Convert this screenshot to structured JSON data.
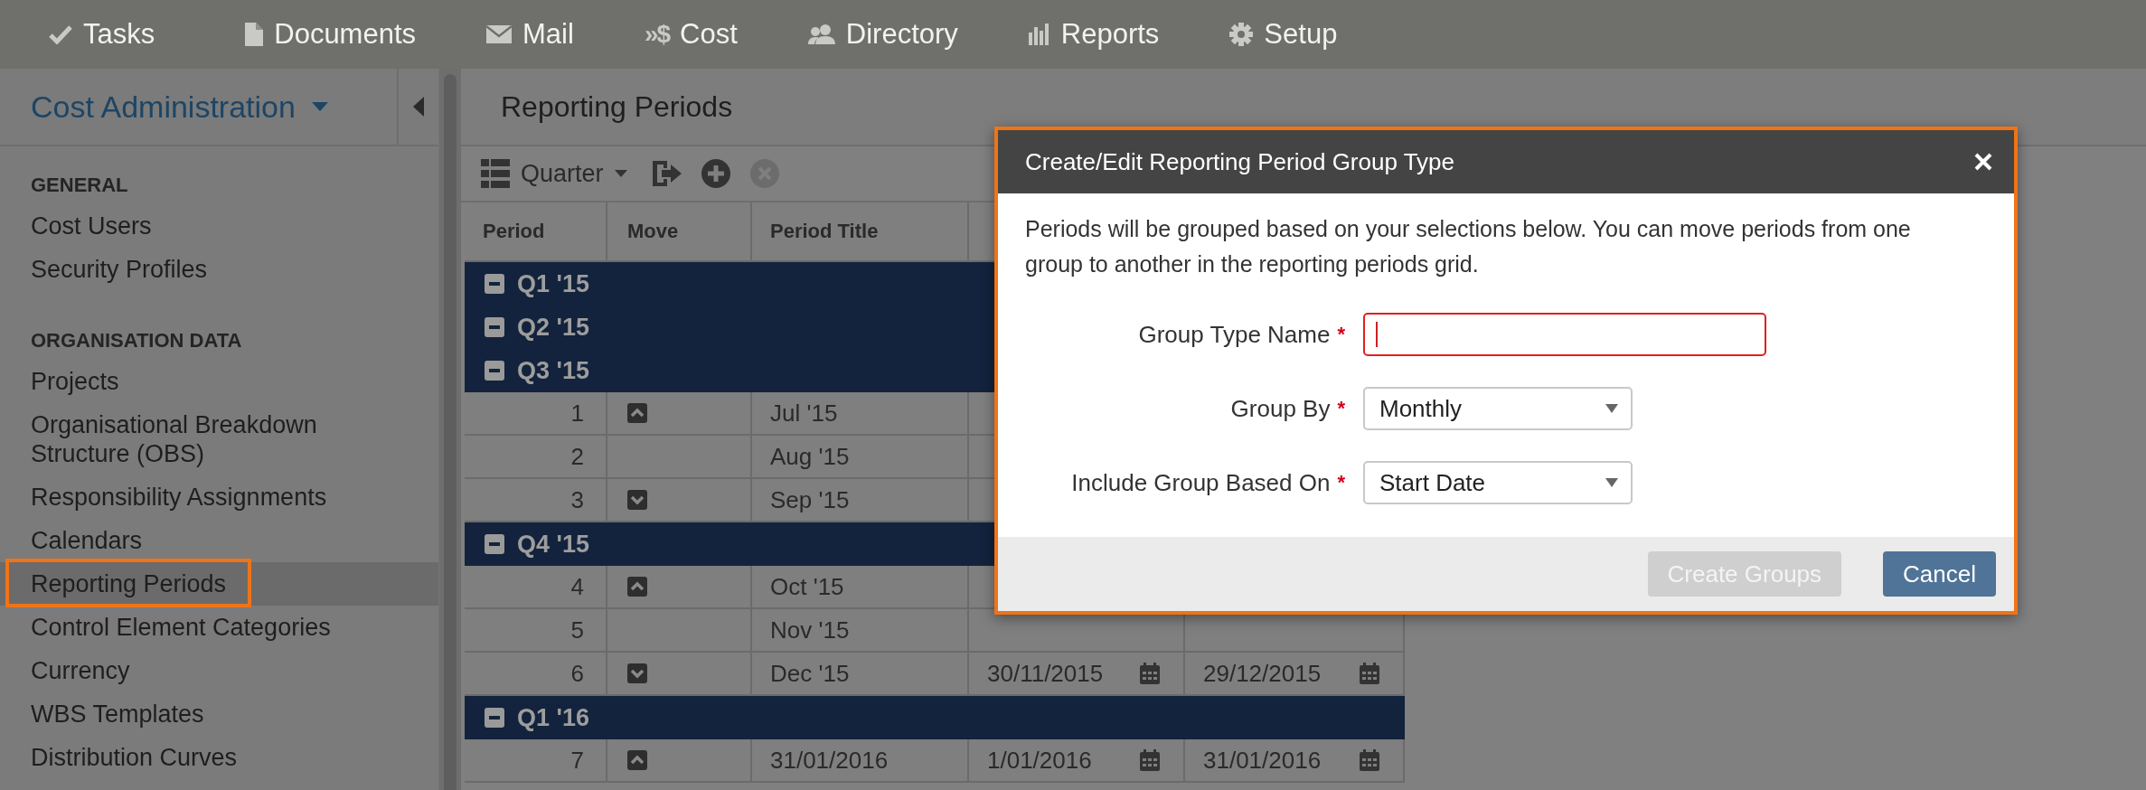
{
  "nav": [
    {
      "label": "Tasks"
    },
    {
      "label": "Documents"
    },
    {
      "label": "Mail"
    },
    {
      "label": "Cost",
      "glyph": "»$"
    },
    {
      "label": "Directory"
    },
    {
      "label": "Reports"
    },
    {
      "label": "Setup"
    }
  ],
  "sidebar": {
    "title": "Cost Administration",
    "sections": [
      {
        "heading": "GENERAL",
        "items": [
          {
            "label": "Cost Users",
            "selected": false
          },
          {
            "label": "Security Profiles",
            "selected": false
          }
        ]
      },
      {
        "heading": "ORGANISATION DATA",
        "items": [
          {
            "label": "Projects",
            "selected": false
          },
          {
            "label": "Organisational Breakdown Structure (OBS)",
            "selected": false
          },
          {
            "label": "Responsibility Assignments",
            "selected": false
          },
          {
            "label": "Calendars",
            "selected": false
          },
          {
            "label": "Reporting Periods",
            "selected": true
          },
          {
            "label": "Control Element Categories",
            "selected": false
          },
          {
            "label": "Currency",
            "selected": false
          },
          {
            "label": "WBS Templates",
            "selected": false
          },
          {
            "label": "Distribution Curves",
            "selected": false
          }
        ]
      }
    ]
  },
  "main": {
    "title": "Reporting Periods",
    "toolbar": {
      "group_by": "Quarter",
      "remove_disabled": true
    },
    "grid": {
      "columns": [
        "Period",
        "Move",
        "Period Title"
      ],
      "rows": [
        {
          "kind": "group",
          "label": "Q1 '15",
          "expanded": true
        },
        {
          "kind": "group",
          "label": "Q2 '15",
          "expanded": true
        },
        {
          "kind": "group",
          "label": "Q3 '15",
          "expanded": true
        },
        {
          "kind": "period",
          "period": "1",
          "can_move_up": true,
          "can_move_down": false,
          "title": "Jul '15"
        },
        {
          "kind": "period",
          "period": "2",
          "can_move_up": false,
          "can_move_down": false,
          "title": "Aug '15"
        },
        {
          "kind": "period",
          "period": "3",
          "can_move_up": false,
          "can_move_down": true,
          "title": "Sep '15"
        },
        {
          "kind": "group",
          "label": "Q4 '15",
          "expanded": true
        },
        {
          "kind": "period",
          "period": "4",
          "can_move_up": true,
          "can_move_down": false,
          "title": "Oct '15"
        },
        {
          "kind": "period",
          "period": "5",
          "can_move_up": false,
          "can_move_down": false,
          "title": "Nov '15"
        },
        {
          "kind": "period",
          "period": "6",
          "can_move_up": false,
          "can_move_down": true,
          "title": "Dec '15",
          "start": "30/11/2015",
          "end": "29/12/2015"
        },
        {
          "kind": "group",
          "label": "Q1 '16",
          "expanded": true
        },
        {
          "kind": "period",
          "period": "7",
          "can_move_up": true,
          "can_move_down": false,
          "title": "31/01/2016",
          "start": "1/01/2016",
          "end": "31/01/2016"
        }
      ]
    }
  },
  "dialog": {
    "title": "Create/Edit Reporting Period Group Type",
    "description": "Periods will be grouped based on your selections below. You can move periods from one group to another in the reporting periods grid.",
    "fields": [
      {
        "kind": "text",
        "label": "Group Type Name",
        "required_mark": "*",
        "invalid": true,
        "focused": true
      },
      {
        "kind": "select",
        "label": "Group By",
        "required_mark": "*",
        "value": "Monthly"
      },
      {
        "kind": "select",
        "label": "Include Group Based On",
        "required_mark": "*",
        "value": "Start Date"
      }
    ],
    "buttons": [
      {
        "label": "Create Groups",
        "disabled": true
      },
      {
        "label": "Cancel",
        "disabled": false
      }
    ]
  }
}
